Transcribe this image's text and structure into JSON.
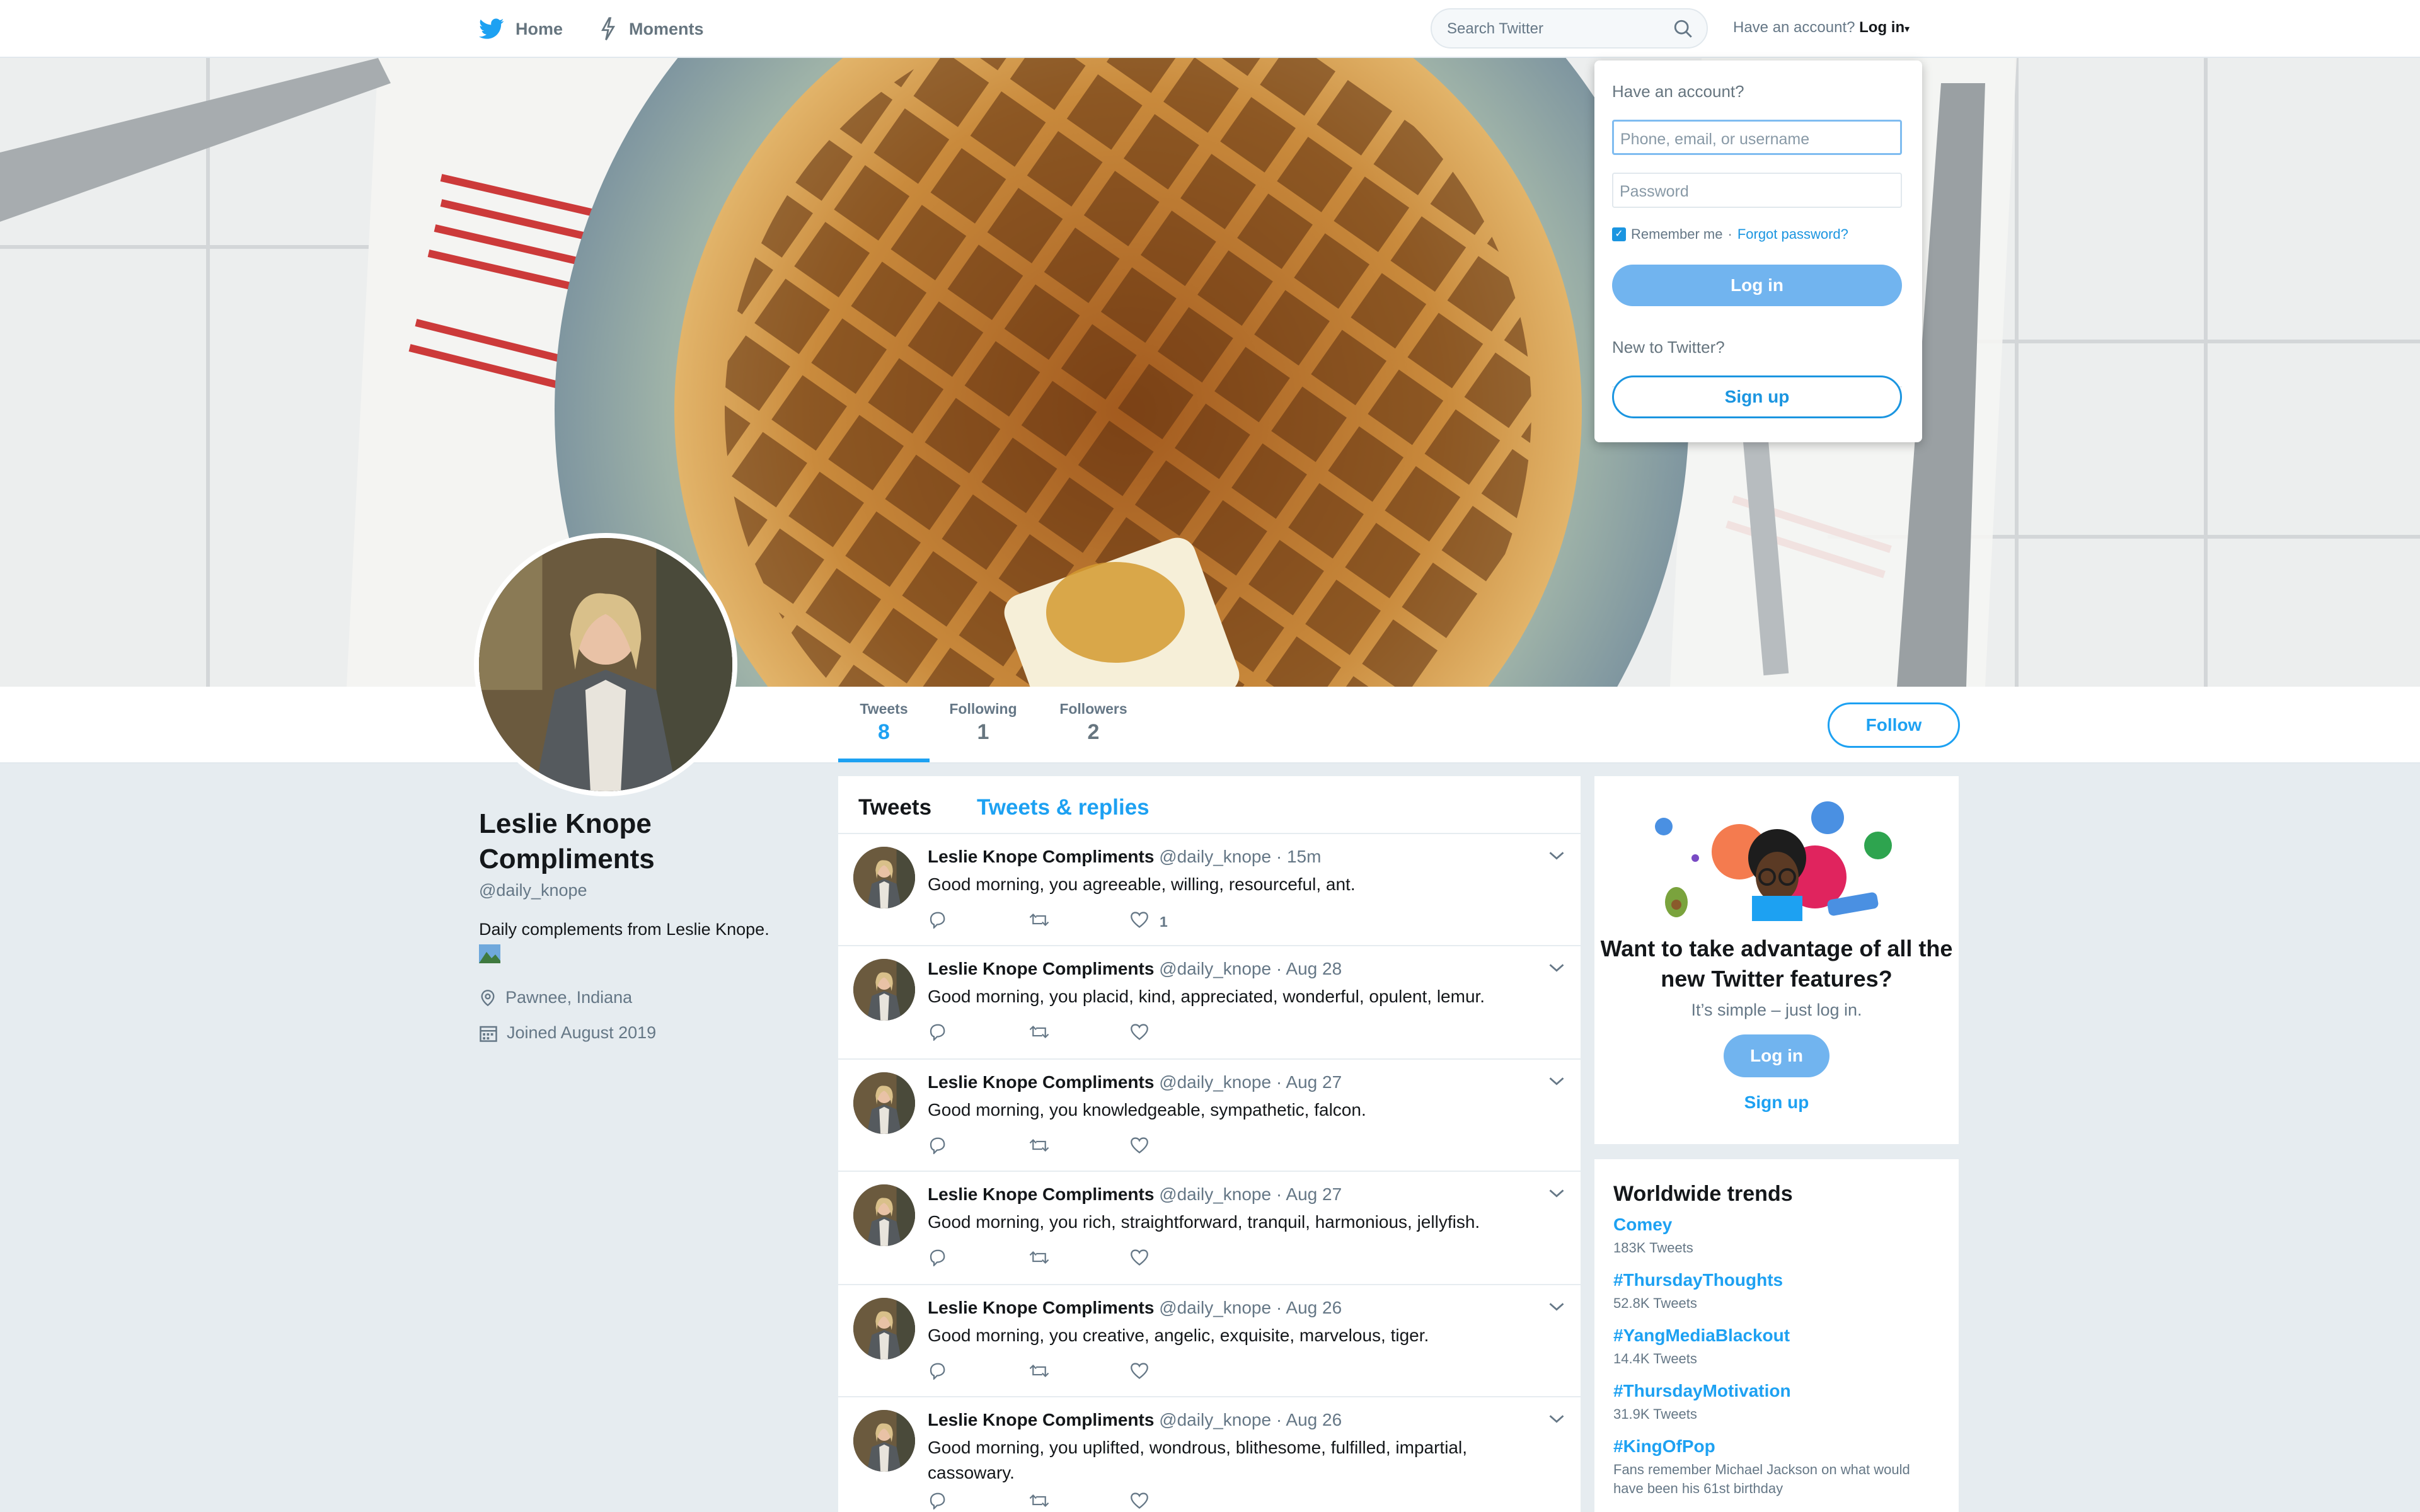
{
  "nav": {
    "home": "Home",
    "moments": "Moments",
    "search_placeholder": "Search Twitter",
    "have_account": "Have an account?",
    "log_in": "Log in"
  },
  "login_dropdown": {
    "heading": "Have an account?",
    "username_placeholder": "Phone, email, or username",
    "password_placeholder": "Password",
    "remember_me": "Remember me",
    "separator": "·",
    "forgot": "Forgot password?",
    "login_button": "Log in",
    "new_to_twitter": "New to Twitter?",
    "signup_button": "Sign up"
  },
  "profile": {
    "name": "Leslie Knope Compliments",
    "handle": "@daily_knope",
    "bio": "Daily complements from Leslie Knope.",
    "location": "Pawnee, Indiana",
    "joined": "Joined August 2019",
    "follow_button": "Follow",
    "stats": [
      {
        "label": "Tweets",
        "value": "8"
      },
      {
        "label": "Following",
        "value": "1"
      },
      {
        "label": "Followers",
        "value": "2"
      }
    ]
  },
  "timeline": {
    "tabs": [
      "Tweets",
      "Tweets & replies"
    ],
    "tweets": [
      {
        "name": "Leslie Knope Compliments",
        "meta": "@daily_knope · 15m",
        "text": "Good morning, you agreeable, willing, resourceful, ant.",
        "likes": "1"
      },
      {
        "name": "Leslie Knope Compliments",
        "meta": "@daily_knope · Aug 28",
        "text": "Good morning, you placid, kind, appreciated, wonderful, opulent, lemur.",
        "likes": ""
      },
      {
        "name": "Leslie Knope Compliments",
        "meta": "@daily_knope · Aug 27",
        "text": "Good morning, you knowledgeable, sympathetic, falcon.",
        "likes": ""
      },
      {
        "name": "Leslie Knope Compliments",
        "meta": "@daily_knope · Aug 27",
        "text": "Good morning, you rich, straightforward, tranquil, harmonious, jellyfish.",
        "likes": ""
      },
      {
        "name": "Leslie Knope Compliments",
        "meta": "@daily_knope · Aug 26",
        "text": "Good morning, you creative, angelic, exquisite, marvelous, tiger.",
        "likes": ""
      },
      {
        "name": "Leslie Knope Compliments",
        "meta": "@daily_knope · Aug 26",
        "text": "Good morning, you uplifted, wondrous, blithesome, fulfilled, impartial, cassowary.",
        "likes": ""
      }
    ]
  },
  "promo": {
    "title": "Want to take advantage of all the new Twitter features?",
    "subtitle": "It’s simple – just log in.",
    "login": "Log in",
    "signup": "Sign up"
  },
  "trends": {
    "heading": "Worldwide trends",
    "items": [
      {
        "name": "Comey",
        "count": "183K Tweets"
      },
      {
        "name": "#ThursdayThoughts",
        "count": "52.8K Tweets"
      },
      {
        "name": "#YangMediaBlackout",
        "count": "14.4K Tweets"
      },
      {
        "name": "#ThursdayMotivation",
        "count": "31.9K Tweets"
      },
      {
        "name": "#KingOfPop",
        "count": "Fans remember Michael Jackson on what would have been his 61st birthday"
      }
    ]
  },
  "colors": {
    "accent": "#1da1f2",
    "button_light": "#71b4ef",
    "background": "#e6ecf0"
  }
}
